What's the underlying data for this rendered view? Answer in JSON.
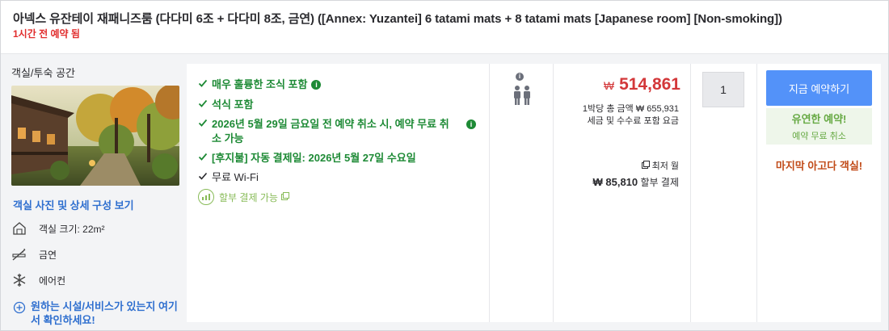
{
  "header": {
    "title": "아넥스 유잔테이 재패니즈룸 (다다미 6조 + 다다미 8조, 금연) ([Annex: Yuzantei] 6 tatami mats + 8 tatami mats [Japanese room] [Non-smoking])",
    "subtitle": "1시간 전 예약 됨"
  },
  "room": {
    "section_title": "객실/투숙 공간",
    "photo_link": "객실 사진 및 상세 구성 보기",
    "features": [
      {
        "icon": "room-size-icon",
        "label": "객실 크기: 22m²"
      },
      {
        "icon": "no-smoking-icon",
        "label": "금연"
      },
      {
        "icon": "snowflake-icon",
        "label": "에어컨"
      }
    ],
    "more_link": "원하는 시설/서비스가 있는지 여기서 확인하세요!"
  },
  "benefits": [
    {
      "text": "매우 훌륭한 조식 포함",
      "style": "green",
      "info": true
    },
    {
      "text": "석식 포함",
      "style": "green",
      "info": false
    },
    {
      "text": "2026년 5월 29일 금요일 전 예약 취소 시, 예약 무료 취소 가능",
      "style": "green",
      "info": true
    },
    {
      "text": "[후지불] 자동 결제일: 2026년 5월 27일 수요일",
      "style": "green",
      "info": false
    },
    {
      "text": "무료 Wi-Fi",
      "style": "dark",
      "info": false
    }
  ],
  "installment_label": "할부 결제 가능",
  "price": {
    "currency": "₩",
    "amount": "514,861",
    "total_line": "1박당 총 금액 ₩ 655,931",
    "tax_line": "세금 및 수수료 포함 요금",
    "min_month_label": "최저 월",
    "installment_amount": "₩ 85,810",
    "installment_suffix": "할부 결제"
  },
  "quantity": "1",
  "booking": {
    "button_label": "지금 예약하기",
    "flex_title": "유연한 예약!",
    "flex_sub": "예약 무료 취소",
    "urgency": "마지막 아고다 객실!"
  },
  "colors": {
    "price_red": "#d3383a",
    "benefit_green": "#1d8a35",
    "link_blue": "#2f6fcf",
    "button_blue": "#5392f9",
    "urgency_orange": "#c14b19"
  }
}
